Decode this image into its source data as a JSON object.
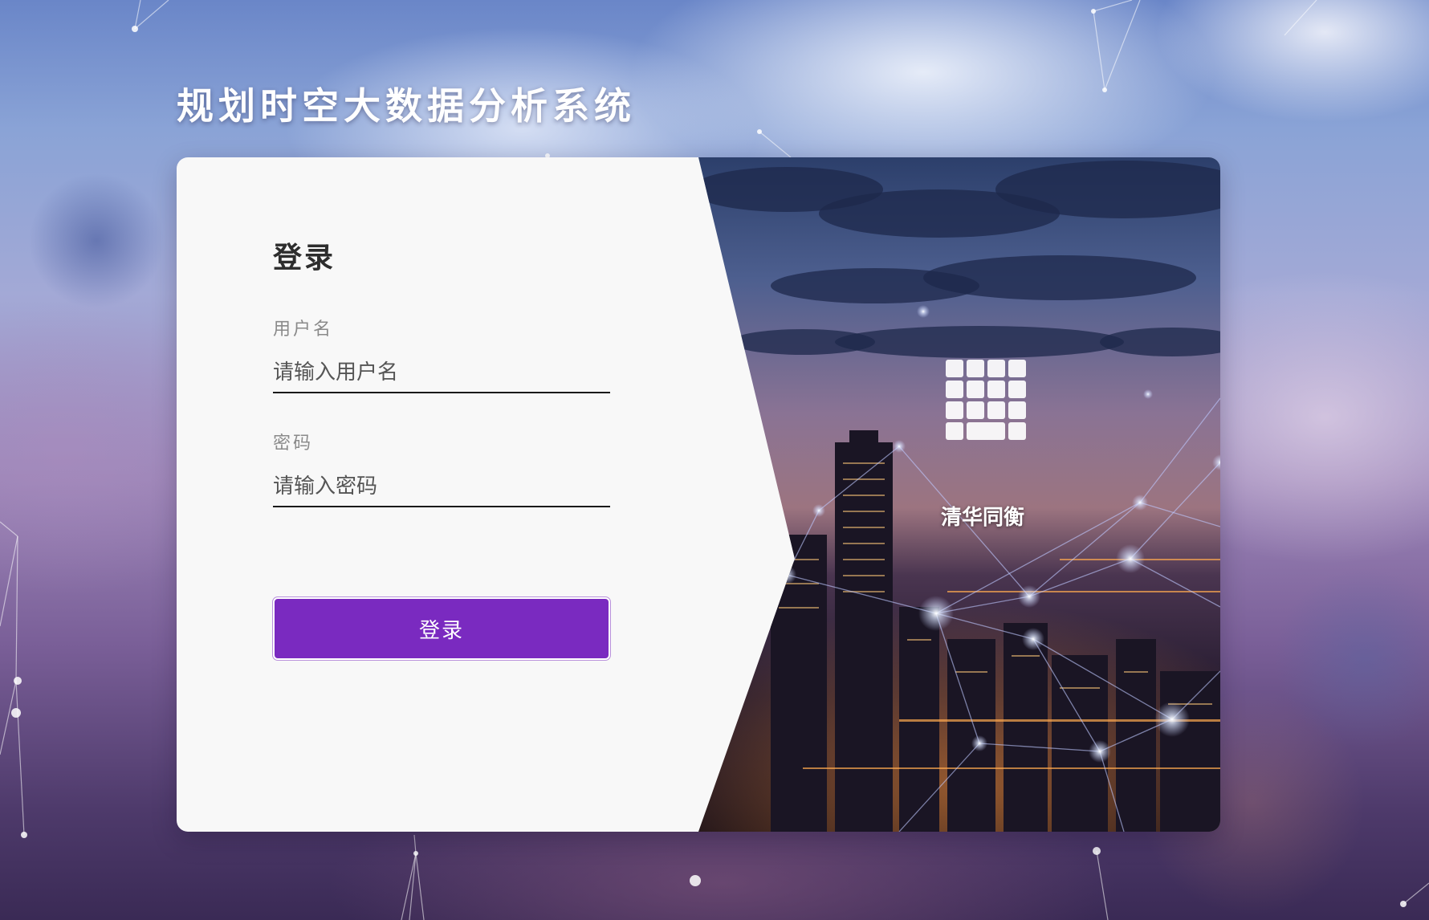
{
  "app": {
    "title": "规划时空大数据分析系统"
  },
  "login": {
    "heading": "登录",
    "username": {
      "label": "用户名",
      "placeholder": "请输入用户名",
      "value": ""
    },
    "password": {
      "label": "密码",
      "placeholder": "请输入密码",
      "value": ""
    },
    "submit_label": "登录"
  },
  "brand": {
    "name": "清华同衡",
    "logo_icon": "grid-logo-icon"
  },
  "colors": {
    "accent": "#7a2ac0",
    "panel_background": "#f8f8f8",
    "heading_text": "#2d2d2d",
    "label_text": "#8a8a8a"
  }
}
